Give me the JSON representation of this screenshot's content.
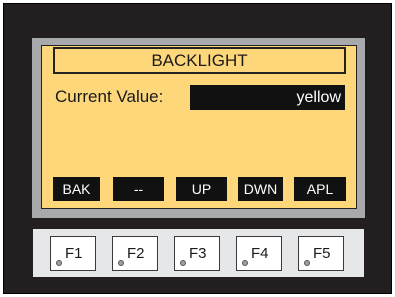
{
  "screen": {
    "title": "BACKLIGHT",
    "current_value_label": "Current Value:",
    "current_value": "yellow"
  },
  "softkeys": [
    "BAK",
    "--",
    "UP",
    "DWN",
    "APL"
  ],
  "function_keys": [
    "F1",
    "F2",
    "F3",
    "F4",
    "F5"
  ],
  "colors": {
    "housing": "#231f20",
    "bezel": "#a7a9ac",
    "lcd_background": "#fdd77a",
    "softkey_background": "#111111",
    "softkey_text": "#ffffff",
    "function_panel": "#e6e7e8"
  }
}
